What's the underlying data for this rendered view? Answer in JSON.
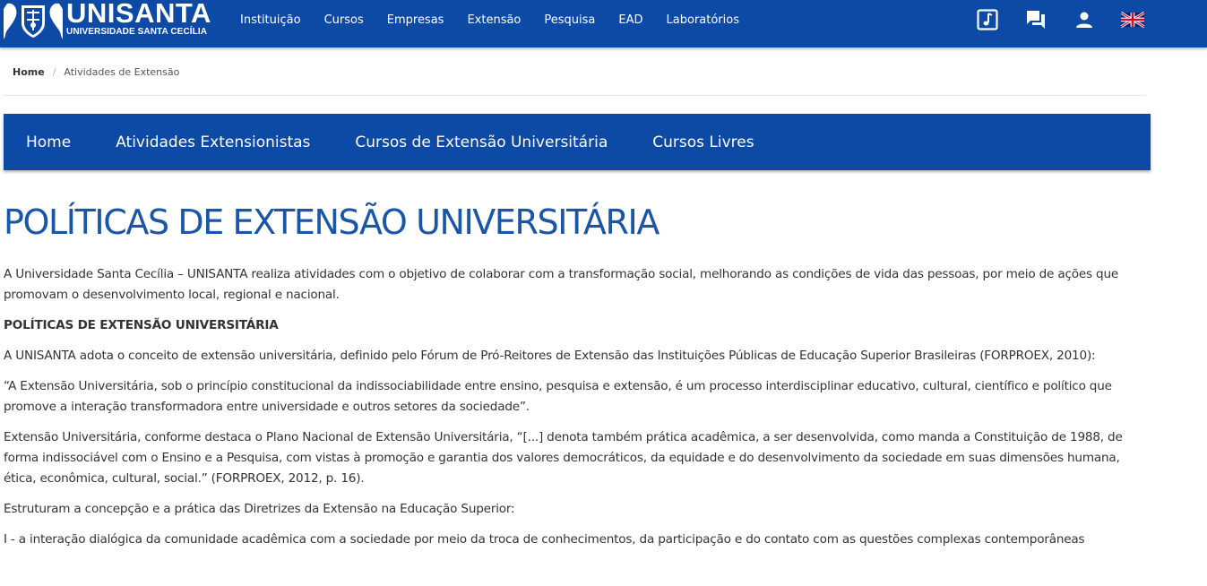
{
  "header": {
    "logo_name": "UNISANTA",
    "logo_sub": "UNIVERSIDADE SANTA CECÍLIA",
    "nav": [
      "Instituição",
      "Cursos",
      "Empresas",
      "Extensão",
      "Pesquisa",
      "EAD",
      "Laboratórios"
    ],
    "icons": [
      "music-icon",
      "chat-icon",
      "user-icon",
      "uk-flag-icon"
    ],
    "brand_color": "#0c4aa6"
  },
  "breadcrumb": {
    "home": "Home",
    "separator": "/",
    "current": "Atividades de Extensão"
  },
  "subnav": {
    "items": [
      "Home",
      "Atividades Extensionistas",
      "Cursos de Extensão Universitária",
      "Cursos Livres"
    ]
  },
  "content": {
    "title": "POLÍTICAS DE EXTENSÃO UNIVERSITÁRIA",
    "paragraphs": [
      "A Universidade Santa Cecília – UNISANTA realiza atividades com o objetivo de colaborar com a transformação social, melhorando as condições de vida das pessoas, por meio de ações que promovam o desenvolvimento local, regional e nacional.",
      "POLÍTICAS DE EXTENSÃO UNIVERSITÁRIA",
      "A UNISANTA adota o conceito de extensão universitária, definido pelo Fórum de Pró-Reitores de Extensão das Instituições Públicas de Educação Superior Brasileiras (FORPROEX, 2010):",
      "“A Extensão Universitária, sob o princípio constitucional da indissociabilidade entre ensino, pesquisa e extensão, é um processo interdisciplinar educativo, cultural, científico e político que promove a interação transformadora entre universidade e outros setores da sociedade”.",
      "Extensão Universitária, conforme destaca o Plano Nacional de Extensão Universitária, “[...] denota também prática acadêmica, a ser desenvolvida, como manda a Constituição de 1988, de forma indissociável com o Ensino e a Pesquisa, com vistas à promoção e garantia dos valores democráticos, da equidade e do desenvolvimento da sociedade em suas dimensões humana, ética, econômica, cultural, social.” (FORPROEX, 2012, p. 16).",
      "Estruturam a concepção e a prática das Diretrizes da Extensão na Educação Superior:",
      "I - a interação dialógica da comunidade acadêmica com a sociedade por meio da troca de conhecimentos, da participação e do contato com as questões complexas contemporâneas"
    ]
  }
}
